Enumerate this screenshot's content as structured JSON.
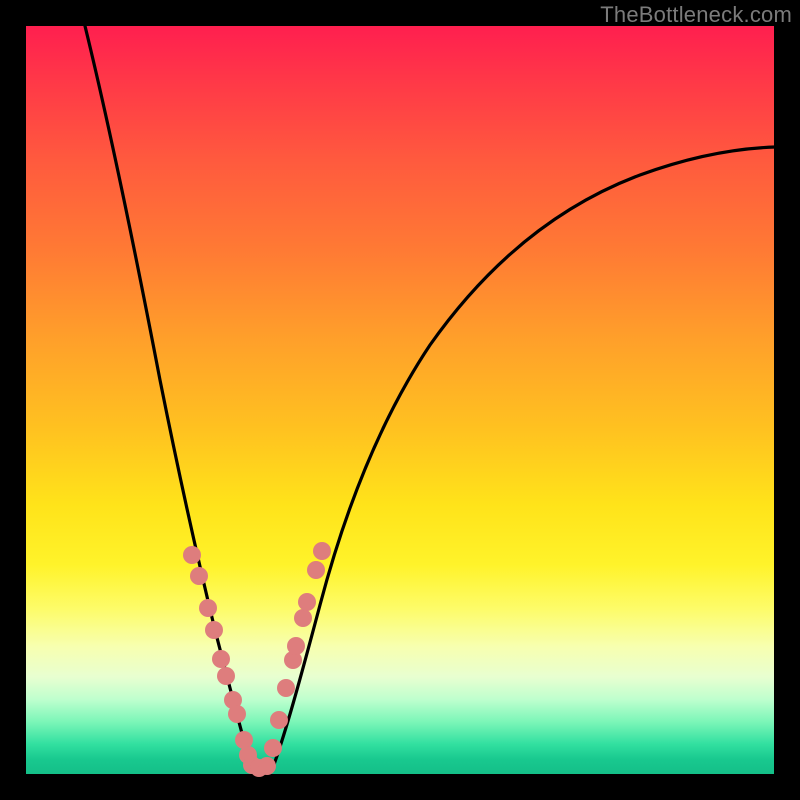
{
  "watermark": {
    "text": "TheBottleneck.com"
  },
  "chart_data": {
    "type": "line",
    "title": "",
    "xlabel": "",
    "ylabel": "",
    "xlim": [
      0,
      100
    ],
    "ylim": [
      0,
      100
    ],
    "grid": false,
    "legend": "none",
    "background": "vertical-gradient red→orange→yellow→green (top→bottom)",
    "series": [
      {
        "name": "left-branch",
        "color": "#000000",
        "x": [
          8,
          10,
          12,
          14,
          16,
          18,
          19,
          20,
          21,
          22,
          23,
          24,
          25,
          26,
          27,
          28,
          29
        ],
        "y": [
          100,
          88,
          76,
          65,
          55,
          45,
          41,
          36,
          32,
          28,
          24,
          20,
          16,
          12,
          8,
          4,
          1
        ]
      },
      {
        "name": "right-branch",
        "color": "#000000",
        "x": [
          31,
          32,
          33,
          34,
          36,
          38,
          40,
          44,
          48,
          54,
          60,
          68,
          76,
          84,
          92,
          100
        ],
        "y": [
          1,
          5,
          9,
          13,
          20,
          27,
          33,
          43,
          51,
          60,
          66,
          72,
          76.5,
          80,
          82.5,
          84.5
        ]
      }
    ],
    "points_overlay": {
      "color": "#de7d7d",
      "radius_approx": 1.2,
      "points": [
        {
          "x": 21.5,
          "y": 30
        },
        {
          "x": 22.5,
          "y": 27
        },
        {
          "x": 23.5,
          "y": 22.5
        },
        {
          "x": 24.2,
          "y": 19.5
        },
        {
          "x": 25.2,
          "y": 15.5
        },
        {
          "x": 25.8,
          "y": 13.5
        },
        {
          "x": 26.8,
          "y": 10
        },
        {
          "x": 27.3,
          "y": 8
        },
        {
          "x": 28.3,
          "y": 4.5
        },
        {
          "x": 28.7,
          "y": 2.5
        },
        {
          "x": 29.3,
          "y": 1
        },
        {
          "x": 30.2,
          "y": 0.8
        },
        {
          "x": 31.2,
          "y": 1
        },
        {
          "x": 32.0,
          "y": 3.5
        },
        {
          "x": 32.8,
          "y": 7.5
        },
        {
          "x": 33.8,
          "y": 12
        },
        {
          "x": 34.6,
          "y": 15.5
        },
        {
          "x": 35.0,
          "y": 17.5
        },
        {
          "x": 36.0,
          "y": 21.5
        },
        {
          "x": 36.5,
          "y": 23.5
        },
        {
          "x": 37.8,
          "y": 28
        },
        {
          "x": 38.5,
          "y": 30.5
        }
      ]
    }
  }
}
